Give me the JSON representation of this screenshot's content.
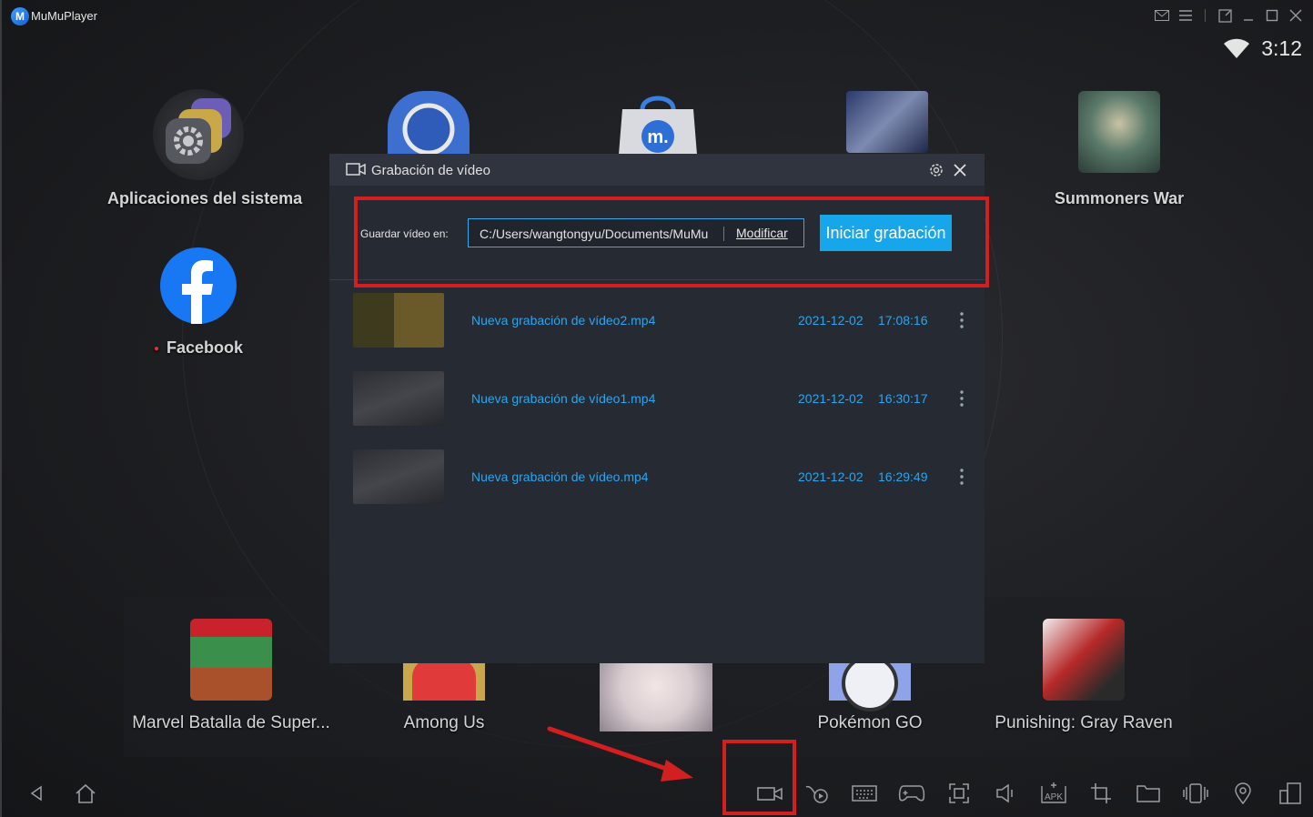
{
  "window": {
    "title": "MuMuPlayer",
    "logo_letter": "M"
  },
  "status": {
    "time": "3:12"
  },
  "desktop_apps": [
    {
      "label": "Aplicaciones del sistema"
    },
    {
      "label": "Facebook"
    },
    {
      "label": "Summoners War"
    }
  ],
  "dock_apps": [
    {
      "label": "Marvel Batalla de Super..."
    },
    {
      "label": "Among Us"
    },
    {
      "label": "Pokémon GO"
    },
    {
      "label": "Punishing: Gray Raven"
    }
  ],
  "dialog": {
    "title": "Grabación de vídeo",
    "save_label": "Guardar vídeo en:",
    "save_path": "C:/Users/wangtongyu/Documents/MuMu",
    "modify_label": "Modificar",
    "start_label": "Iniciar grabación",
    "recordings": [
      {
        "name": "Nueva grabación de vídeo2.mp4",
        "date": "2021-12-02",
        "time": "17:08:16"
      },
      {
        "name": "Nueva grabación de vídeo1.mp4",
        "date": "2021-12-02",
        "time": "16:30:17"
      },
      {
        "name": "Nueva grabación de vídeo.mp4",
        "date": "2021-12-02",
        "time": "16:29:49"
      }
    ]
  },
  "colors": {
    "accent": "#17a6ea",
    "link": "#2aa6f0",
    "highlight": "#d21f1f"
  },
  "toolbar_icons": [
    "back-icon",
    "home-icon",
    "video-record-icon",
    "macro-icon",
    "keyboard-icon",
    "gamepad-icon",
    "screenshot-icon",
    "volume-icon",
    "apk-install-icon",
    "crop-icon",
    "folder-icon",
    "shake-icon",
    "location-icon",
    "multi-window-icon"
  ]
}
